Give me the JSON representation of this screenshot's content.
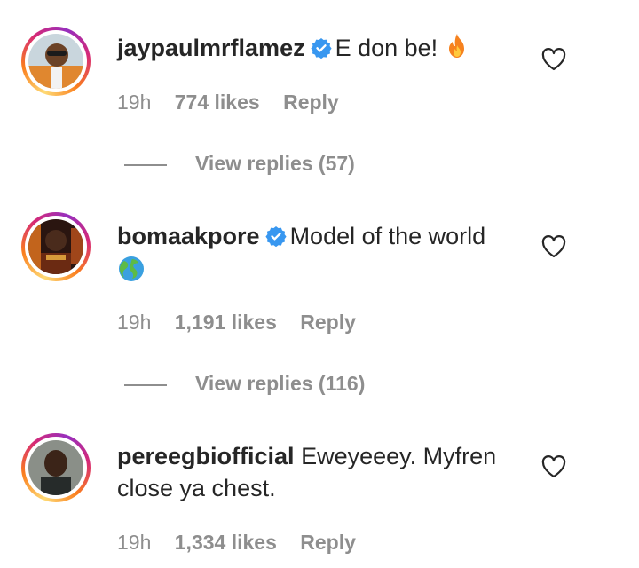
{
  "comments": [
    {
      "username": "jaypaulmrflamez",
      "text": "E don be!",
      "emoji": "fire",
      "time": "19h",
      "likes": "774 likes",
      "reply": "Reply",
      "view_replies": "View replies (57)"
    },
    {
      "username": "bomaakpore",
      "text": "Model of the world",
      "emoji": "globe",
      "time": "19h",
      "likes": "1,191 likes",
      "reply": "Reply",
      "view_replies": "View replies (116)"
    },
    {
      "username": "pereegbiofficial",
      "text": "Eweyeeey. Myfren close ya chest.",
      "time": "19h",
      "likes": "1,334 likes",
      "reply": "Reply"
    }
  ],
  "colors": {
    "text": "#262626",
    "secondary": "#8e8e8e",
    "verified": "#3897f0"
  },
  "icons": [
    "verified-badge-icon",
    "heart-outline-icon",
    "fire-emoji",
    "globe-emoji"
  ]
}
